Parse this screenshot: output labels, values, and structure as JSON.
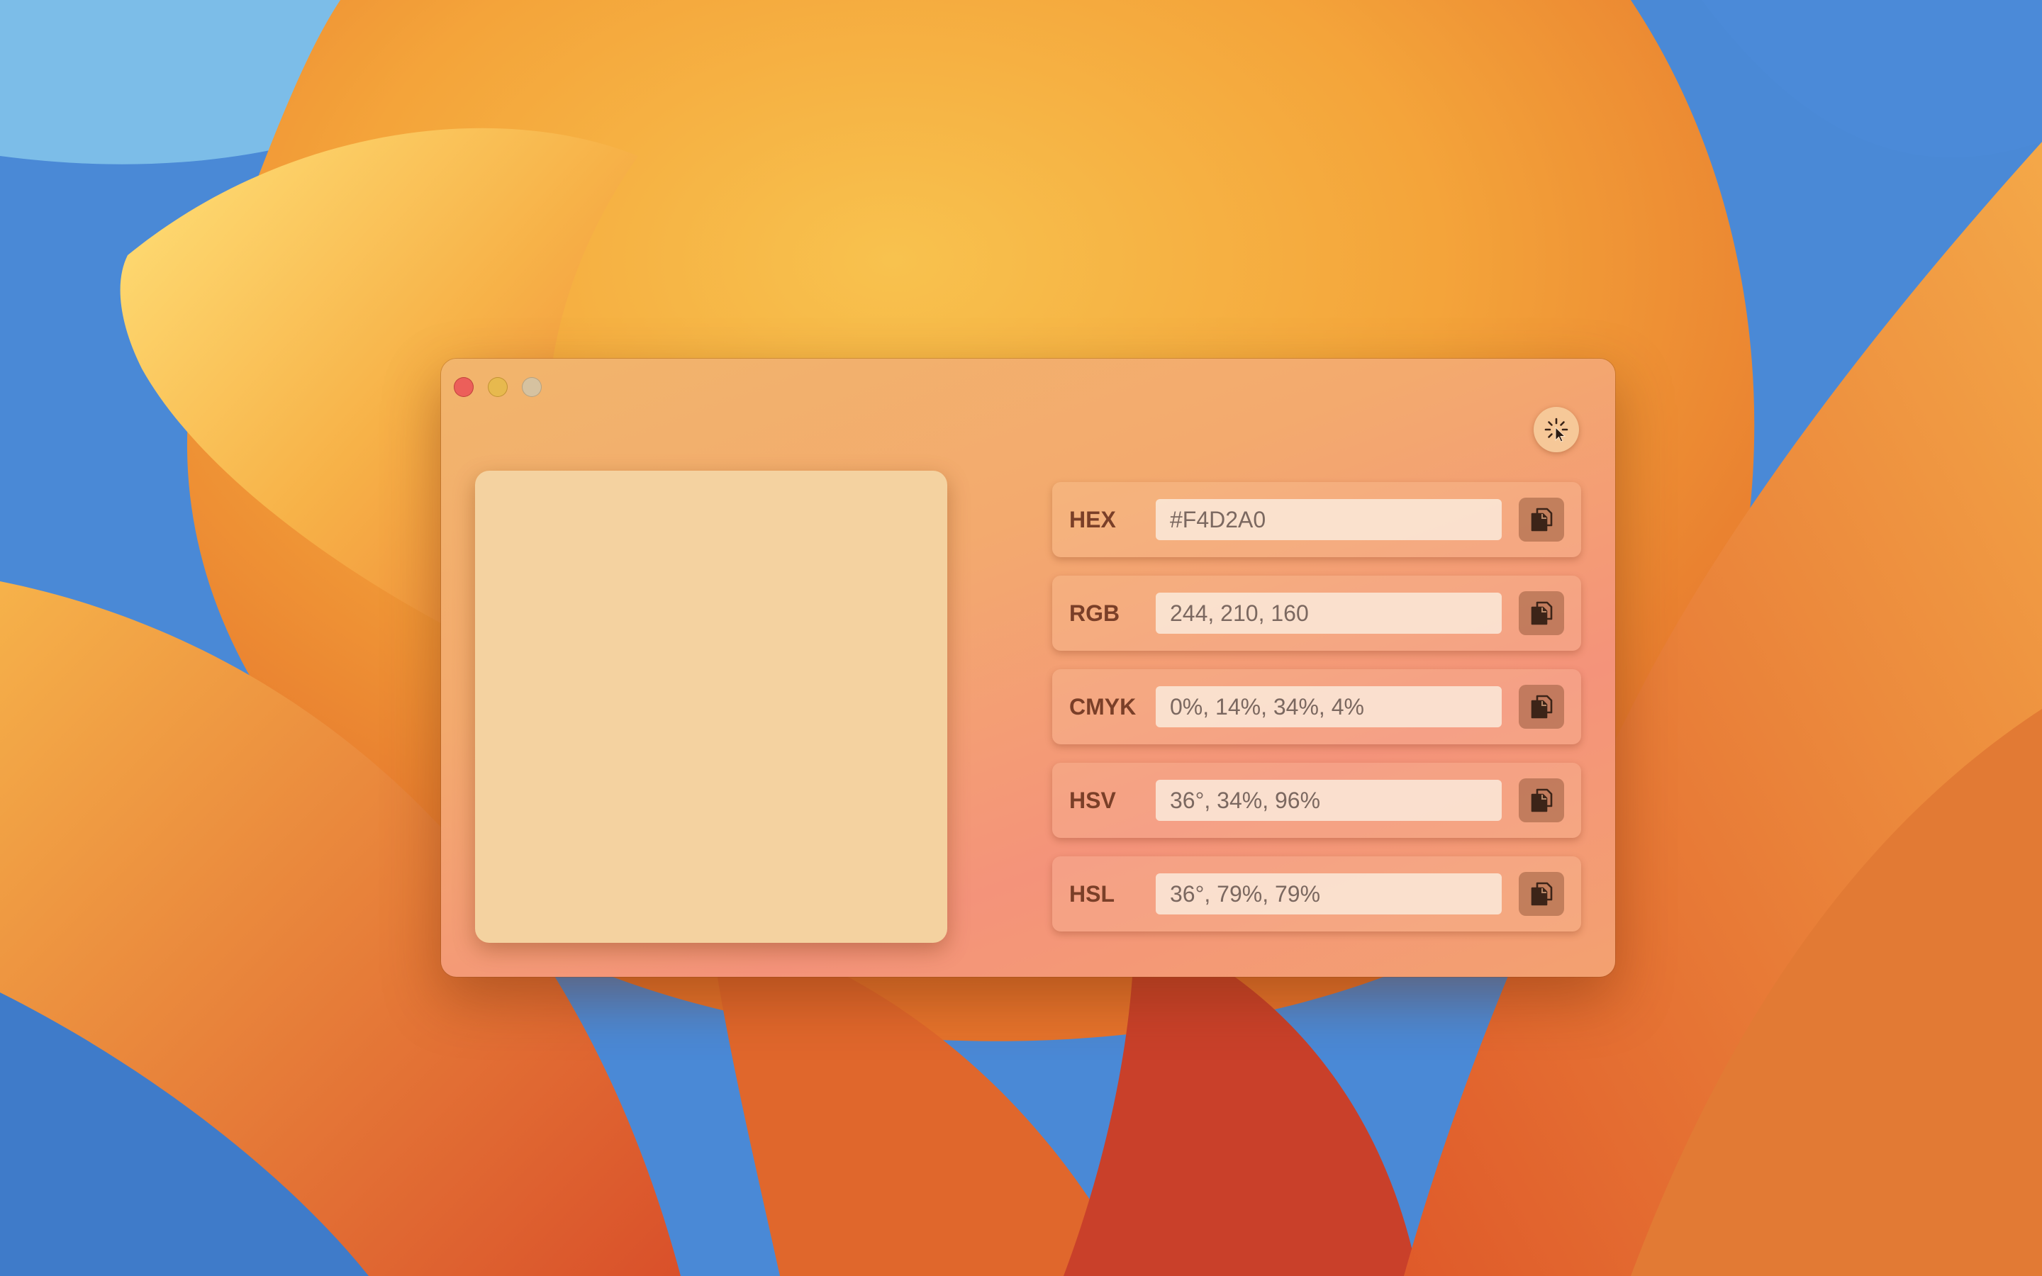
{
  "picked_color": "#F4D2A0",
  "rows": [
    {
      "label": "HEX",
      "value": "#F4D2A0"
    },
    {
      "label": "RGB",
      "value": "244, 210, 160"
    },
    {
      "label": "CMYK",
      "value": "0%, 14%, 34%, 4%"
    },
    {
      "label": "HSV",
      "value": "36°, 34%, 96%"
    },
    {
      "label": "HSL",
      "value": "36°, 79%, 79%"
    }
  ],
  "icons": {
    "picker": "color-picker-icon",
    "copy": "copy-icon"
  },
  "colors": {
    "traffic_close": "#ec5f5a",
    "traffic_minimize": "#e7b94e",
    "traffic_zoom": "#d6c2a0"
  }
}
